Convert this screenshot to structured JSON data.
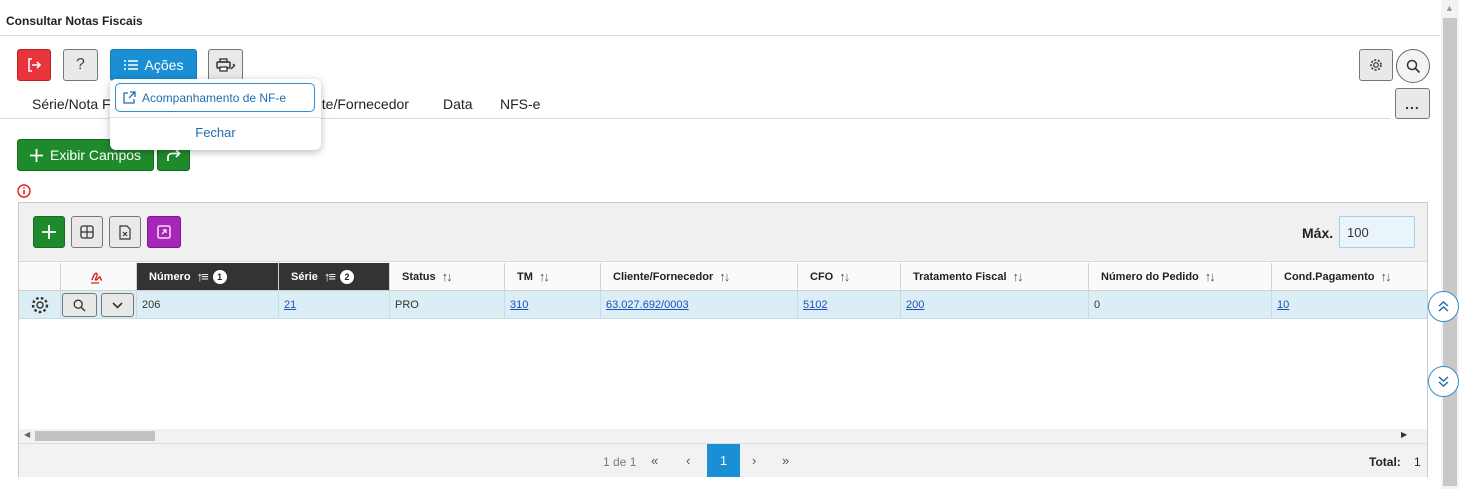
{
  "window": {
    "title": "Consultar Notas Fiscais"
  },
  "toolbar": {
    "exit_icon": "logout-icon",
    "help_label": "?",
    "acoes_label": "Ações",
    "print_icon": "printer-settings-icon",
    "settings_icon": "gear-icon",
    "search_icon": "search-icon",
    "more_label": "..."
  },
  "dropdown": {
    "item_label": "Acompanhamento de NF-e",
    "item_icon": "external-link-icon",
    "close_label": "Fechar"
  },
  "tabs": [
    "Série/Nota Fi",
    "nte/Fornecedor",
    "Data",
    "NFS-e"
  ],
  "actions": {
    "exibir_label": "Exibir Campos",
    "share_icon": "share-arrow-icon",
    "info_icon": "info-icon"
  },
  "grid": {
    "max_label": "Máx.",
    "max_value": "100",
    "columns": [
      {
        "label": "Número",
        "badge": "1",
        "sort": "asc"
      },
      {
        "label": "Série",
        "badge": "2",
        "sort": "asc"
      },
      {
        "label": "Status"
      },
      {
        "label": "TM"
      },
      {
        "label": "Cliente/Fornecedor"
      },
      {
        "label": "CFO"
      },
      {
        "label": "Tratamento Fiscal"
      },
      {
        "label": "Número do Pedido"
      },
      {
        "label": "Cond.Pagamento"
      }
    ],
    "rows": [
      {
        "numero": "206",
        "serie": "21",
        "status": "PRO",
        "tm": "310",
        "cliente": "63.027.692/0003",
        "cfo": "5102",
        "tratamento": "200",
        "pedido": "0",
        "cond_pagamento": "10"
      }
    ],
    "pager": {
      "page_info": "1 de 1",
      "first": "«",
      "prev": "‹",
      "current": "1",
      "next": "›",
      "last": "»",
      "total_label": "Total:",
      "total_value": "1"
    }
  },
  "colors": {
    "primary": "#1b8fd3",
    "success": "#1e8a2b",
    "danger": "#e8343a",
    "purple": "#a626b8",
    "row": "#dbeef6"
  }
}
